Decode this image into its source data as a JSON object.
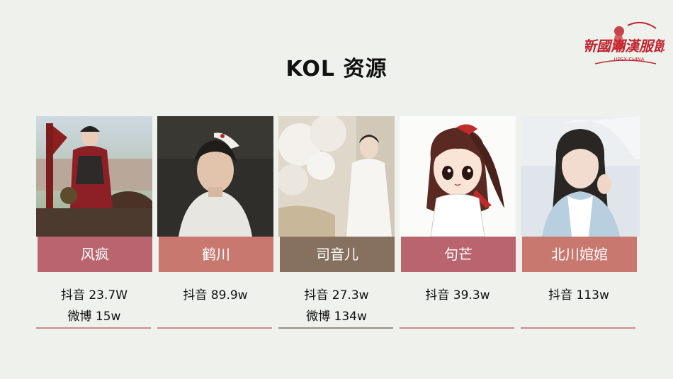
{
  "title": "KOL 资源",
  "logo": {
    "text_main": "新國潮漢服節",
    "text_sub": "UPSX CHINA"
  },
  "kols": [
    {
      "name": "风疯",
      "stat_1": "抖音 23.7W",
      "stat_2": "微博 15w",
      "bar_color": "#b9646e"
    },
    {
      "name": "鹤川",
      "stat_1": "抖音 89.9w",
      "stat_2": "",
      "bar_color": "#c8786e"
    },
    {
      "name": "司音儿",
      "stat_1": "抖音 27.3w",
      "stat_2": "微博 134w",
      "bar_color": "#86705f"
    },
    {
      "name": "句芒",
      "stat_1": "抖音 39.3w",
      "stat_2": "",
      "bar_color": "#b9646e"
    },
    {
      "name": "北川婠婠",
      "stat_1": "抖音 113w",
      "stat_2": "",
      "bar_color": "#c8786e"
    }
  ]
}
